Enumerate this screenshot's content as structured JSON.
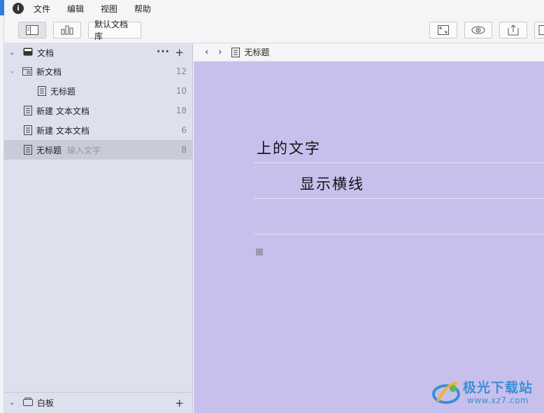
{
  "menubar": {
    "items": [
      "文件",
      "编辑",
      "视图",
      "帮助"
    ]
  },
  "toolbar": {
    "library_label": "默认文档库"
  },
  "sidebar": {
    "header_title": "文档",
    "items": [
      {
        "label": "新文档",
        "count": "12"
      },
      {
        "label": "无标题",
        "count": "10"
      },
      {
        "label": "新建 文本文档",
        "count": "18"
      },
      {
        "label": "新建 文本文档",
        "count": "6"
      },
      {
        "label": "无标题",
        "sub": "输入文字",
        "count": "8"
      }
    ],
    "footer_title": "白板"
  },
  "nav": {
    "title": "无标题"
  },
  "editor": {
    "line1": "上的文字",
    "line2": "显示横线"
  },
  "watermark": {
    "brand": "极光下载站",
    "url": "www.xz7.com"
  },
  "colors": {
    "editor_bg": "#c8c0ec",
    "sidebar_bg": "#dde1ee",
    "selected_row": "#c9ccd8",
    "accent_blue": "#2f7fd6"
  },
  "icons": [
    "info-icon",
    "sidebar-toggle-icon",
    "structure-icon",
    "fullscreen-icon",
    "preview-eye-icon",
    "export-icon",
    "document-icon",
    "folder-icon",
    "whiteboard-icon"
  ]
}
